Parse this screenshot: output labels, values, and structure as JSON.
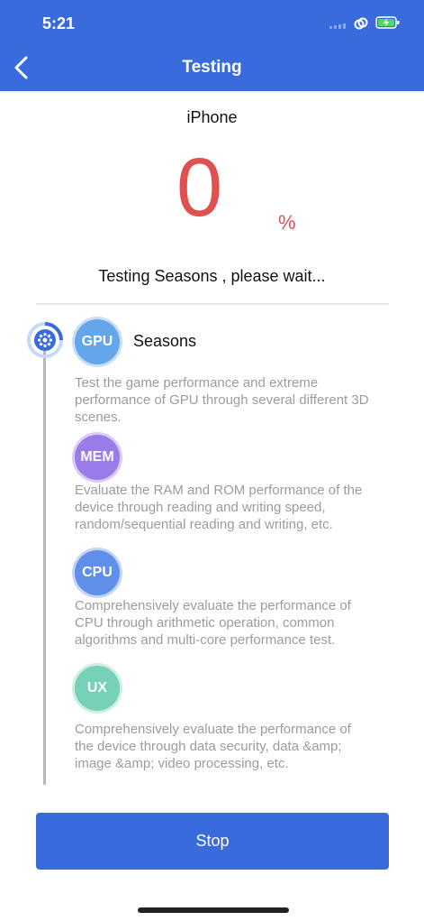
{
  "status_bar": {
    "time": "5:21"
  },
  "nav": {
    "title": "Testing"
  },
  "device": "iPhone",
  "progress": {
    "value": "0",
    "unit": "%"
  },
  "status_text": "Testing Seasons  , please wait...",
  "tests": [
    {
      "badge": "GPU",
      "title": "Seasons",
      "description": "Test the game performance and extreme performance of GPU through several different 3D scenes."
    },
    {
      "badge": "MEM",
      "title": "",
      "description": "Evaluate the RAM and ROM performance of the device through reading and writing speed, random/sequential reading and writing, etc."
    },
    {
      "badge": "CPU",
      "title": "",
      "description": "Comprehensively evaluate the performance of CPU through arithmetic operation, common algorithms and multi-core performance test."
    },
    {
      "badge": "UX",
      "title": "",
      "description": "Comprehensively evaluate the performance of the device through data security, data &amp; image &amp; video processing, etc."
    }
  ],
  "stop_label": "Stop",
  "colors": {
    "primary": "#3a6bdc",
    "progress": "#e0504f",
    "gpu": "#63a6e9",
    "mem": "#9a7be7",
    "cpu": "#5f8fe9",
    "ux": "#77d0b8"
  }
}
